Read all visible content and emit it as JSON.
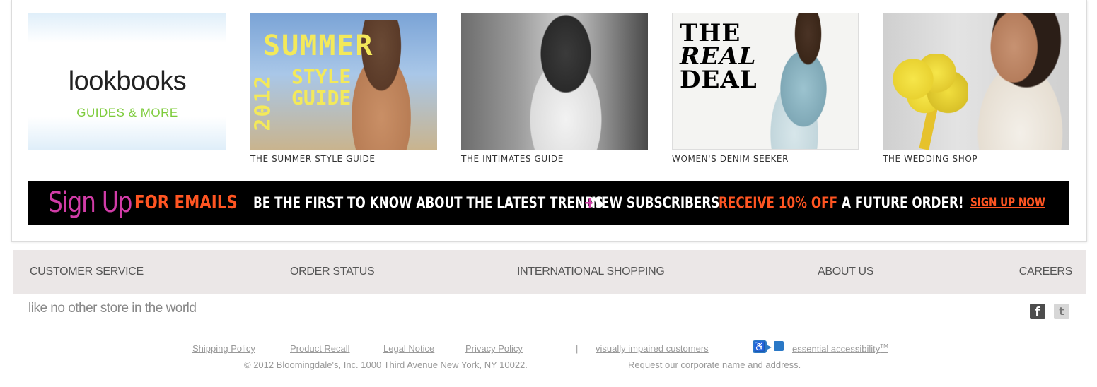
{
  "lookbooks": {
    "title": "lookbooks",
    "subtitle": "GUIDES & MORE"
  },
  "tiles": [
    {
      "caption": "THE SUMMER STYLE GUIDE",
      "overlay": {
        "line1": "SUMMER",
        "year": "2012",
        "line2": "STYLE",
        "line3": "GUIDE"
      }
    },
    {
      "caption": "THE INTIMATES GUIDE"
    },
    {
      "caption": "WOMEN'S DENIM SEEKER",
      "overlay": {
        "line1": "THE",
        "line2": "REAL",
        "line3": "DEAL"
      }
    },
    {
      "caption": "THE WEDDING SHOP"
    }
  ],
  "banner": {
    "sign_up": "Sign Up",
    "for_emails": "FOR EMAILS",
    "first_to_know": "BE THE FIRST TO KNOW ABOUT THE LATEST TRENDS",
    "plus": "+",
    "new_subscribers": "NEW SUBSCRIBERS",
    "receive": "RECEIVE 10% OFF",
    "future_order": "A FUTURE ORDER!",
    "cta": "SIGN UP NOW",
    "colors": {
      "pink": "#d13ca7",
      "orange": "#ff5522",
      "background": "#000000"
    }
  },
  "footer_nav": {
    "customer_service": "CUSTOMER SERVICE",
    "order_status": "ORDER STATUS",
    "international_shopping": "INTERNATIONAL SHOPPING",
    "about_us": "ABOUT US",
    "careers": "CAREERS"
  },
  "tagline": "like no other store in the world",
  "social": {
    "facebook_glyph": "f",
    "twitter_glyph": "t"
  },
  "legal": {
    "shipping_policy": "Shipping Policy",
    "product_recall": "Product Recall",
    "legal_notice": "Legal Notice",
    "privacy_policy": "Privacy Policy",
    "separator": "|",
    "visually_impaired": "visually impaired customers",
    "essential_accessibility": "essential accessibility",
    "trademark": "TM",
    "copyright": "© 2012 Bloomingdale's, Inc. 1000 Third Avenue New York, NY 10022.",
    "corporate_link": "Request our corporate name and address."
  }
}
